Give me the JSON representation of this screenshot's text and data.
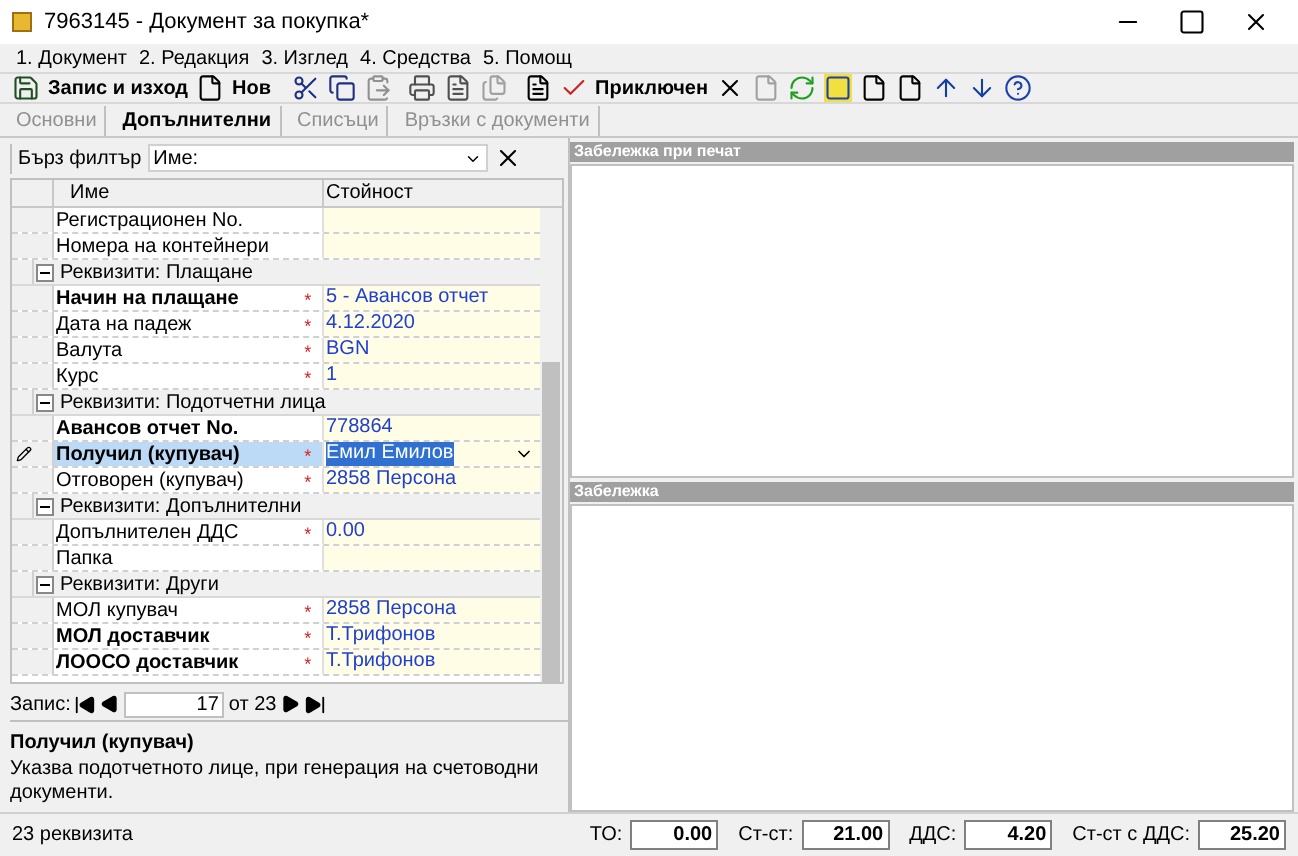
{
  "window": {
    "title": "7963145 - Документ за покупка*"
  },
  "menu": [
    "1. Документ",
    "2. Редакция",
    "3. Изглед",
    "4. Средства",
    "5. Помощ"
  ],
  "toolbar": [
    {
      "label": "Запис и изход"
    },
    {
      "label": "Нов"
    },
    {
      "label": "Приключен"
    }
  ],
  "tabs": [
    {
      "label": "Основни",
      "selected": false
    },
    {
      "label": "Допълнителни",
      "selected": true
    },
    {
      "label": "Списъци",
      "selected": false
    },
    {
      "label": "Връзки с документи",
      "selected": false
    }
  ],
  "filter": {
    "label": "Бърз филтър",
    "field_label": "Име:"
  },
  "grid": {
    "columns": [
      "Име",
      "Стойност"
    ],
    "rows": [
      {
        "kind": "property",
        "name": "Регистрационен No.",
        "bold": false,
        "value": "",
        "selected": false
      },
      {
        "kind": "property",
        "name": "Номера на контейнери",
        "bold": false,
        "value": "",
        "selected": false
      },
      {
        "kind": "group",
        "name": "Реквизити: Плащане",
        "expanded": true
      },
      {
        "kind": "property",
        "name": "Начин на плащане",
        "bold": true,
        "marker": "*",
        "value": "5 - Авансов отчет",
        "selected": false
      },
      {
        "kind": "property",
        "name": "Дата на падеж",
        "bold": false,
        "marker": "*",
        "value": "4.12.2020",
        "selected": false
      },
      {
        "kind": "property",
        "name": "Валута",
        "bold": false,
        "marker": "*",
        "value": "BGN",
        "selected": false
      },
      {
        "kind": "property",
        "name": "Курс",
        "bold": false,
        "marker": "*",
        "value": "1",
        "selected": false
      },
      {
        "kind": "group",
        "name": "Реквизити: Подотчетни лица",
        "expanded": true
      },
      {
        "kind": "property",
        "name": "Авансов отчет No.",
        "bold": true,
        "value": "778864",
        "selected": false
      },
      {
        "kind": "property",
        "name": "Получил (купувач)",
        "bold": true,
        "marker": "*",
        "value": "Емил Емилов",
        "selected": true
      },
      {
        "kind": "property",
        "name": "Отговорен (купувач)",
        "bold": false,
        "marker": "*",
        "value": "2858 Персона",
        "selected": false
      },
      {
        "kind": "group",
        "name": "Реквизити: Допълнителни",
        "expanded": true
      },
      {
        "kind": "property",
        "name": "Допълнителен ДДС",
        "bold": false,
        "marker": "*",
        "value": "0.00",
        "selected": false
      },
      {
        "kind": "property",
        "name": "Папка",
        "bold": false,
        "value": "",
        "selected": false
      },
      {
        "kind": "group",
        "name": "Реквизити: Други",
        "expanded": true
      },
      {
        "kind": "property",
        "name": "МОЛ купувач",
        "bold": false,
        "marker": "*",
        "value": "2858 Персона",
        "selected": false
      },
      {
        "kind": "property",
        "name": "МОЛ доставчик",
        "bold": true,
        "marker": "*",
        "value": "Т.Трифонов",
        "selected": false
      },
      {
        "kind": "property",
        "name": "ЛООСО доставчик",
        "bold": true,
        "marker": "*",
        "value": "Т.Трифонов",
        "selected": false
      }
    ]
  },
  "navigator": {
    "label": "Запис:",
    "current": "17",
    "total": "от 23"
  },
  "description": {
    "title": "Получил (купувач)",
    "text": "Указва подотчетното лице, при генерация на счетоводни документи."
  },
  "notes": [
    {
      "title": "Забележка при печат"
    },
    {
      "title": "Забележка"
    }
  ],
  "status_bar": {
    "text": "23 реквизита",
    "totals": [
      {
        "label": "ТО:",
        "value": "0.00"
      },
      {
        "label": "Ст-ст:",
        "value": "21.00"
      },
      {
        "label": "ДДС:",
        "value": "4.20"
      },
      {
        "label": "Ст-ст с ДДС:",
        "value": "25.20"
      }
    ]
  }
}
